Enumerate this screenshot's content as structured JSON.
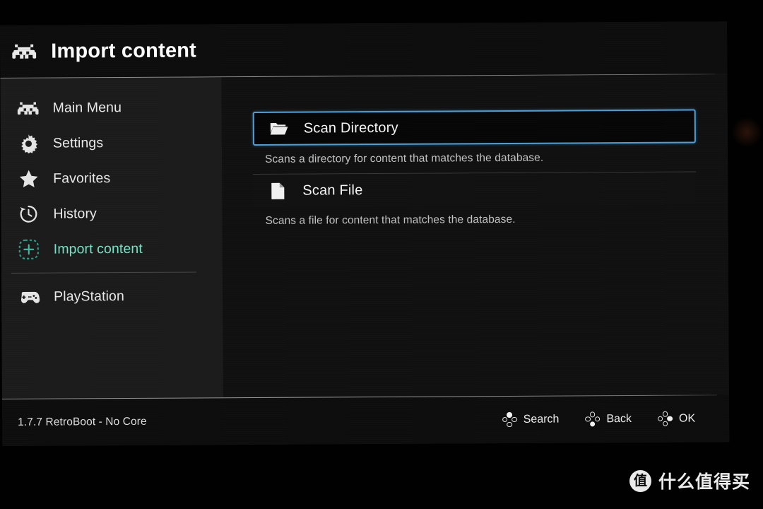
{
  "app": {
    "header": {
      "icon": "retroarch-logo-icon",
      "title": "Import content"
    },
    "sidebar": {
      "items": [
        {
          "id": "main-menu",
          "label": "Main Menu",
          "icon": "retroarch-logo-icon",
          "active": false
        },
        {
          "id": "settings",
          "label": "Settings",
          "icon": "gear-icon",
          "active": false
        },
        {
          "id": "favorites",
          "label": "Favorites",
          "icon": "star-icon",
          "active": false
        },
        {
          "id": "history",
          "label": "History",
          "icon": "history-clock-icon",
          "active": false
        },
        {
          "id": "import-content",
          "label": "Import content",
          "icon": "dashed-plus-icon",
          "active": true
        }
      ],
      "playlists": [
        {
          "id": "playstation",
          "label": "PlayStation",
          "icon": "gamepad-icon",
          "active": false
        }
      ]
    },
    "content": {
      "entries": [
        {
          "id": "scan-directory",
          "label": "Scan Directory",
          "icon": "folder-icon",
          "description": "Scans a directory for content that matches the database.",
          "selected": true
        },
        {
          "id": "scan-file",
          "label": "Scan File",
          "icon": "file-icon",
          "description": "Scans a file for content that matches the database.",
          "selected": false
        }
      ]
    },
    "footer": {
      "version": "1.7.7 RetroBoot - No Core",
      "actions": [
        {
          "id": "search",
          "label": "Search",
          "button": "triangle",
          "icon": "ps-button-cluster-icon"
        },
        {
          "id": "back",
          "label": "Back",
          "button": "cross",
          "icon": "ps-button-cluster-icon"
        },
        {
          "id": "ok",
          "label": "OK",
          "button": "circle",
          "icon": "ps-button-cluster-icon"
        }
      ]
    },
    "colors": {
      "accent_selected_border": "#4c9fd6",
      "accent_active_label": "#76e0c4",
      "panel_bg": "#161616",
      "sidebar_bg": "#1b1b1b",
      "content_bg": "#101010",
      "header_bg": "#0d0d0d"
    }
  },
  "watermark": {
    "badge": "值",
    "text": "什么值得买"
  }
}
